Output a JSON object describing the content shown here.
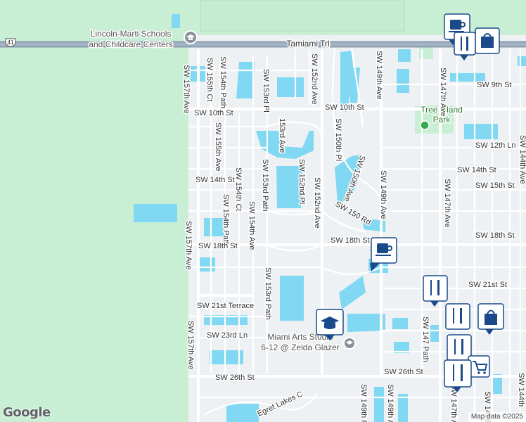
{
  "map": {
    "highway_shield": "41",
    "highway_name": "Tamiami Trl",
    "school_top": [
      "Lincoln-Marti Schools",
      "and Childcare Centers"
    ],
    "school_bottom": [
      "Miami Arts Studio",
      "6-12 @ Zelda Glazer"
    ],
    "park_name": [
      "Tree Island",
      "Park"
    ],
    "street_labels": {
      "sw157_top": "SW 157th Ave",
      "sw155ct": "SW 155th Ct",
      "sw154path_top": "SW 154th Path",
      "sw153pl": "SW 153rd Pl",
      "sw152_top": "SW 152nd Ave",
      "sw149_top": "SW 149th Ave",
      "sw147_top": "SW 147th Ave",
      "sw9": "SW 9th St",
      "sw10_w": "SW 10th St",
      "sw10_e": "SW 10th St",
      "ave153": "153rd Ave",
      "sw150pl": "SW 150th Pl",
      "sw150ave": "SW 150th Ave",
      "sw12ln": "SW 12th Ln",
      "sw144_top": "SW 144th Ave",
      "sw155ave": "SW 155th Ave",
      "sw14_w": "SW 14th St",
      "sw154ct": "SW 154th Ct",
      "sw153path": "SW 153rd Path",
      "sw152pl": "SW 152nd Pl",
      "sw149_mid": "SW 149th Ave",
      "sw14_e": "SW 14th St",
      "sw15": "SW 15th St",
      "sw147_mid": "SW 147th Ave",
      "sw154path_mid": "SW 154th Path",
      "sw154ave": "SW 154th Ave",
      "sw152_mid": "SW 152nd Ave",
      "sw150rd": "SW 150 Rd",
      "sw157_mid": "SW 157th Ave",
      "sw18_w": "SW 18th St",
      "sw18_mid": "SW 18th St",
      "sw18_e": "SW 18th St",
      "sw21_e": "SW 21st St",
      "sw153path_low": "SW 153rd Path",
      "sw21terr": "SW 21st Terrace",
      "sw23ln": "SW 23rd Ln",
      "sw147path": "SW 147 Path",
      "sw157_low": "SW 157th Ave",
      "sw26_w": "SW 26th St",
      "sw26_e": "SW 26th St",
      "sw149pl": "SW 149th Pl",
      "sw149_low": "SW 149th Ave",
      "sw147_low": "SW 147th Ave",
      "sw145": "SW 145th",
      "sw144_low": "SW 144th",
      "egret": "Egret Lakes C"
    },
    "pins": [
      {
        "icon": "coffee-cup"
      },
      {
        "icon": "coffee-cup"
      },
      {
        "icon": "fork-knife"
      },
      {
        "icon": "fork-knife"
      },
      {
        "icon": "shopping-bag"
      },
      {
        "icon": "fork-knife"
      },
      {
        "icon": "fork-knife"
      },
      {
        "icon": "fork-knife"
      },
      {
        "icon": "graduation-cap"
      },
      {
        "icon": "shopping-cart"
      }
    ],
    "colors": {
      "land": "#eef1f4",
      "green": "#c8efd4",
      "water": "#80d8f2",
      "road": "#ffffff",
      "highway": "#8a9bad",
      "pin": "#1a4a8a"
    }
  },
  "branding": {
    "logo": "Google",
    "attribution": "Map data ©2025"
  }
}
